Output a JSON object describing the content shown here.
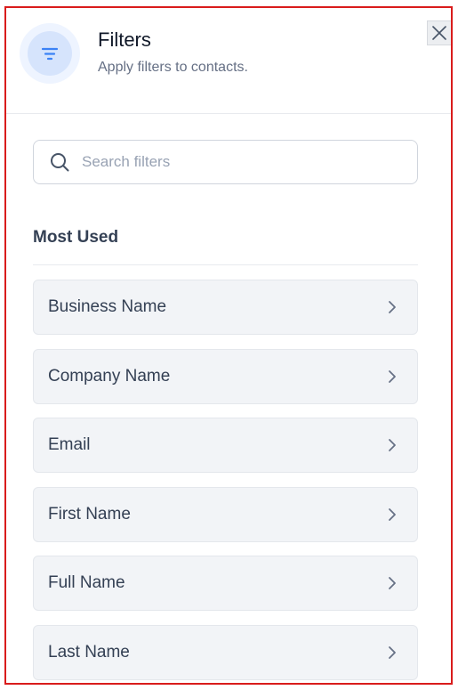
{
  "header": {
    "title": "Filters",
    "subtitle": "Apply filters to contacts.",
    "icon": "filter-icon",
    "close_icon": "close-icon"
  },
  "search": {
    "placeholder": "Search filters",
    "value": "",
    "icon": "search-icon"
  },
  "section": {
    "title": "Most Used"
  },
  "filters": [
    {
      "label": "Business Name",
      "icon": "chevron-right-icon"
    },
    {
      "label": "Company Name",
      "icon": "chevron-right-icon"
    },
    {
      "label": "Email",
      "icon": "chevron-right-icon"
    },
    {
      "label": "First Name",
      "icon": "chevron-right-icon"
    },
    {
      "label": "Full Name",
      "icon": "chevron-right-icon"
    },
    {
      "label": "Last Name",
      "icon": "chevron-right-icon"
    }
  ],
  "colors": {
    "accent": "#3b82f6",
    "border_highlight": "#d91c1c",
    "item_background": "#f2f4f7"
  }
}
